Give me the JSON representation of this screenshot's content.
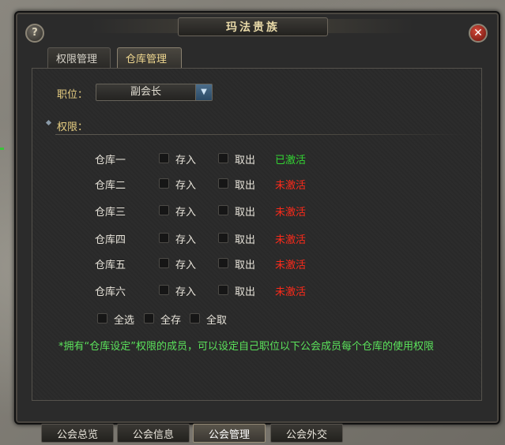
{
  "window": {
    "title": "玛法贵族",
    "help_icon": "?",
    "close_icon": "✕"
  },
  "tabs": [
    {
      "label": "权限管理",
      "active": false
    },
    {
      "label": "仓库管理",
      "active": true
    }
  ],
  "position": {
    "label": "职位：",
    "selected": "副会长",
    "arrow_icon": "chevron-down-icon"
  },
  "permissions": {
    "label": "权限："
  },
  "warehouses": [
    {
      "name": "仓库一",
      "deposit": "存入",
      "withdraw": "取出",
      "status": "已激活",
      "active": true
    },
    {
      "name": "仓库二",
      "deposit": "存入",
      "withdraw": "取出",
      "status": "未激活",
      "active": false
    },
    {
      "name": "仓库三",
      "deposit": "存入",
      "withdraw": "取出",
      "status": "未激活",
      "active": false
    },
    {
      "name": "仓库四",
      "deposit": "存入",
      "withdraw": "取出",
      "status": "未激活",
      "active": false
    },
    {
      "name": "仓库五",
      "deposit": "存入",
      "withdraw": "取出",
      "status": "未激活",
      "active": false
    },
    {
      "name": "仓库六",
      "deposit": "存入",
      "withdraw": "取出",
      "status": "未激活",
      "active": false
    }
  ],
  "bulk": {
    "select_all": "全选",
    "deposit_all": "全存",
    "withdraw_all": "全取"
  },
  "note": "*拥有“仓库设定”权限的成员，可以设定自己职位以下公会成员每个仓库的使用权限",
  "bottom_tabs": [
    {
      "label": "公会总览",
      "active": false
    },
    {
      "label": "公会信息",
      "active": false
    },
    {
      "label": "公会管理",
      "active": true
    },
    {
      "label": "公会外交",
      "active": false
    }
  ],
  "colors": {
    "activated": "#33d633",
    "not_activated": "#ff2a1a",
    "note": "#5be35b",
    "label_gold": "#e8cf82"
  }
}
